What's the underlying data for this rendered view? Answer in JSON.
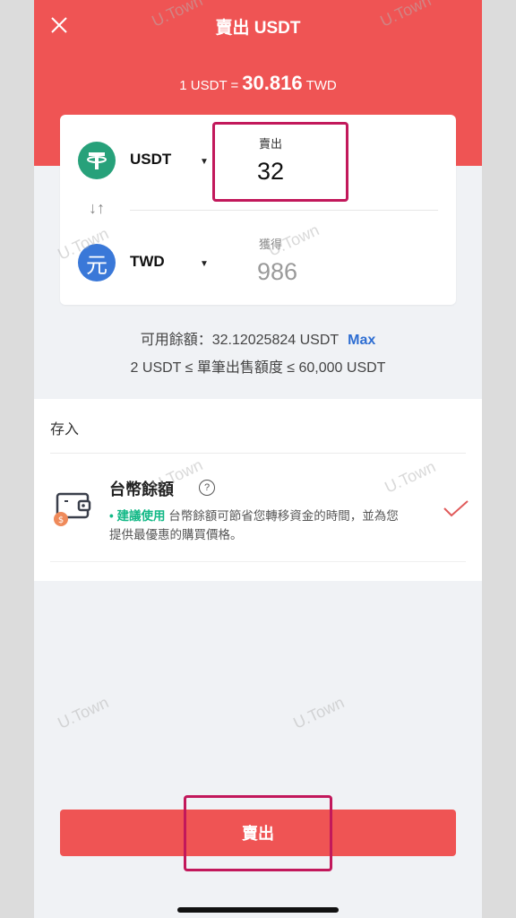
{
  "header": {
    "title": "賣出 USDT",
    "rate_prefix": "1 USDT =",
    "rate_value": "30.816",
    "rate_suffix": "TWD"
  },
  "from": {
    "currency": "USDT",
    "field_label": "賣出",
    "amount": "32"
  },
  "to": {
    "currency": "TWD",
    "icon_text": "元",
    "field_label": "獲得",
    "amount": "986"
  },
  "balance": {
    "text": "可用餘額：32.12025824 USDT",
    "max_label": "Max",
    "limit_text": "2 USDT ≤ 單筆出售額度 ≤ 60,000 USDT"
  },
  "deposit": {
    "section_title": "存入",
    "method_name": "台幣餘額",
    "tag": "• 建議使用",
    "description": "台幣餘額可節省您轉移資金的時間，並為您提供最優惠的購買價格。"
  },
  "action": {
    "sell_label": "賣出"
  },
  "watermark": "U.Town",
  "colors": {
    "header": "#ef5454",
    "usdt": "#27a17a",
    "twd": "#3a78d8",
    "highlight": "#c2185b",
    "max": "#2e6ed2",
    "recommend": "#12b886"
  }
}
